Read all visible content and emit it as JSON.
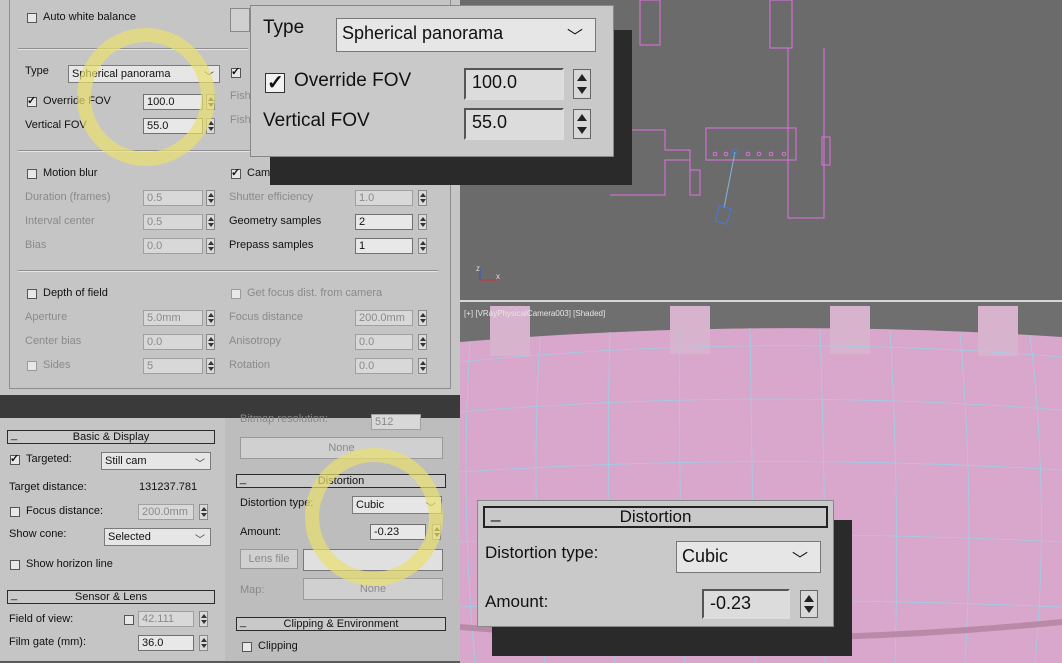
{
  "top_left": {
    "auto_white_balance": "Auto white balance",
    "type_label": "Type",
    "type_value": "Spherical panorama",
    "override_fov": "Override FOV",
    "override_fov_value": "100.0",
    "vertical_fov": "Vertical FOV",
    "vertical_fov_value": "55.0",
    "fish1": "Fish",
    "fish2": "Fish",
    "motion_blur": "Motion blur",
    "duration": "Duration (frames)",
    "duration_value": "0.5",
    "interval_center": "Interval center",
    "interval_center_value": "0.5",
    "bias": "Bias",
    "bias_value": "0.0",
    "camera_motion_blur": "Camera motion blur",
    "shutter_efficiency": "Shutter efficiency",
    "shutter_efficiency_value": "1.0",
    "geometry_samples": "Geometry samples",
    "geometry_samples_value": "2",
    "prepass_samples": "Prepass samples",
    "prepass_samples_value": "1",
    "depth_of_field": "Depth of field",
    "get_focus_dist": "Get focus dist. from camera",
    "aperture": "Aperture",
    "aperture_value": "5.0mm",
    "focus_distance": "Focus distance",
    "focus_distance_value": "200.0mm",
    "center_bias": "Center bias",
    "center_bias_value": "0.0",
    "anisotropy": "Anisotropy",
    "anisotropy_value": "0.0",
    "sides": "Sides",
    "sides_value": "5",
    "rotation": "Rotation",
    "rotation_value": "0.0"
  },
  "zoom_top": {
    "type_label": "Type",
    "type_value": "Spherical panorama",
    "override_fov": "Override FOV",
    "override_fov_value": "100.0",
    "vertical_fov": "Vertical FOV",
    "vertical_fov_value": "55.0"
  },
  "bottom_left": {
    "basic_display": "Basic & Display",
    "targeted": "Targeted:",
    "targeted_value": "Still cam",
    "target_distance": "Target distance:",
    "target_distance_value": "131237.781",
    "focus_distance": "Focus distance:",
    "focus_distance_value": "200.0mm",
    "show_cone": "Show cone:",
    "show_cone_value": "Selected",
    "show_horizon_line": "Show horizon line",
    "sensor_lens": "Sensor & Lens",
    "field_of_view": "Field of view:",
    "field_of_view_value": "42.111",
    "film_gate": "Film gate (mm):",
    "film_gate_value": "36.0"
  },
  "bottom_mid": {
    "bitmap_resolution": "Bitmap resolution:",
    "bitmap_resolution_value": "512",
    "none_button": "None",
    "distortion_header": "Distortion",
    "distortion_type": "Distortion type:",
    "distortion_type_value": "Cubic",
    "amount": "Amount:",
    "amount_value": "-0.23",
    "lens_file": "Lens file",
    "map": "Map:",
    "map_none": "None",
    "clipping_environment": "Clipping & Environment",
    "clipping": "Clipping"
  },
  "zoom_bottom": {
    "header": "Distortion",
    "distortion_type": "Distortion type:",
    "distortion_type_value": "Cubic",
    "amount": "Amount:",
    "amount_value": "-0.23"
  },
  "viewport": {
    "label": "[+] [VRayPhysicalCamera003] [Shaded]",
    "axis_z": "z",
    "axis_x": "x"
  },
  "colors": {
    "highlight_circle": "#e8e07a",
    "wireframe": "#e070e0",
    "pink_surface": "#d9a6cc",
    "panel_bg": "#c5c5c5"
  }
}
